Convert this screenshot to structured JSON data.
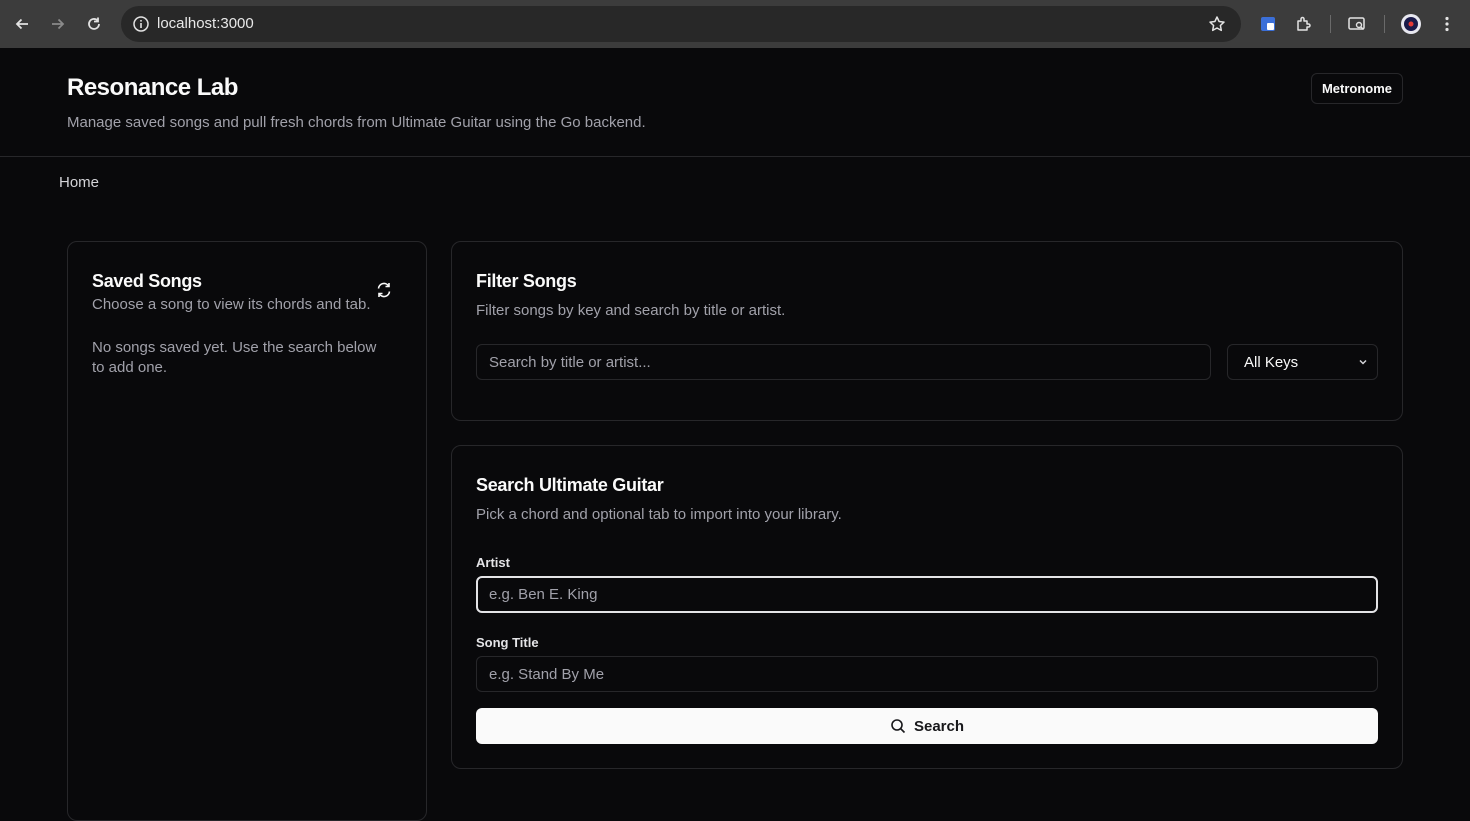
{
  "browser": {
    "url": "localhost:3000",
    "icons": [
      "back-icon",
      "forward-icon",
      "reload-icon",
      "site-info-icon",
      "bookmark-star-icon",
      "extension-shield-icon",
      "extensions-puzzle-icon",
      "tab-search-icon",
      "profile-icon",
      "more-menu-icon"
    ]
  },
  "header": {
    "title": "Resonance Lab",
    "subtitle": "Manage saved songs and pull fresh chords from Ultimate Guitar using the Go backend.",
    "metronome_label": "Metronome"
  },
  "breadcrumb": {
    "home": "Home"
  },
  "saved_songs": {
    "title": "Saved Songs",
    "description": "Choose a song to view its chords and tab.",
    "empty_message": "No songs saved yet. Use the search below to add one."
  },
  "filter": {
    "title": "Filter Songs",
    "description": "Filter songs by key and search by title or artist.",
    "search_placeholder": "Search by title or artist...",
    "key_selected": "All Keys"
  },
  "ug_search": {
    "title": "Search Ultimate Guitar",
    "description": "Pick a chord and optional tab to import into your library.",
    "artist_label": "Artist",
    "artist_placeholder": "e.g. Ben E. King",
    "title_label": "Song Title",
    "title_placeholder": "e.g. Stand By Me",
    "search_label": "Search"
  },
  "colors": {
    "background": "#09090b",
    "border": "#27272a",
    "muted_text": "#a1a1aa",
    "primary_button": "#fafafa"
  }
}
